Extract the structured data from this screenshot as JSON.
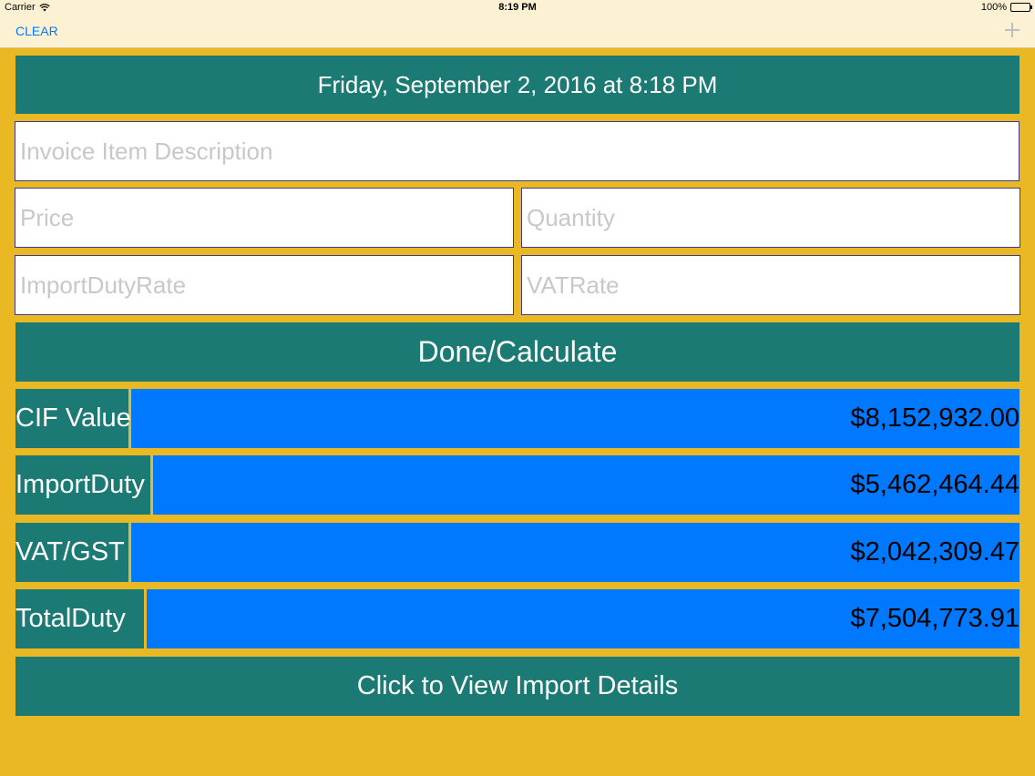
{
  "status_bar": {
    "carrier": "Carrier",
    "time": "8:19 PM",
    "battery": "100%"
  },
  "nav": {
    "clear_label": "CLEAR",
    "add_icon": "plus-icon"
  },
  "header": {
    "date_text": "Friday, September 2, 2016 at 8:18 PM"
  },
  "form": {
    "description_placeholder": "Invoice Item Description",
    "price_placeholder": "Price",
    "quantity_placeholder": "Quantity",
    "import_duty_rate_placeholder": "ImportDutyRate",
    "vat_rate_placeholder": "VATRate",
    "calculate_label": "Done/Calculate"
  },
  "results": [
    {
      "label": "CIF Value",
      "value": "$8,152,932.00"
    },
    {
      "label": "ImportDuty",
      "value": "$5,462,464.44"
    },
    {
      "label": "VAT/GST",
      "value": "$2,042,309.47"
    },
    {
      "label": "TotalDuty",
      "value": "$7,504,773.91"
    }
  ],
  "footer": {
    "details_label": "Click to View Import Details"
  },
  "colors": {
    "background": "#EAB822",
    "teal": "#1C7A74",
    "blue": "#0079FF",
    "nav_background": "#FCF2D3",
    "link": "#007AFF"
  }
}
